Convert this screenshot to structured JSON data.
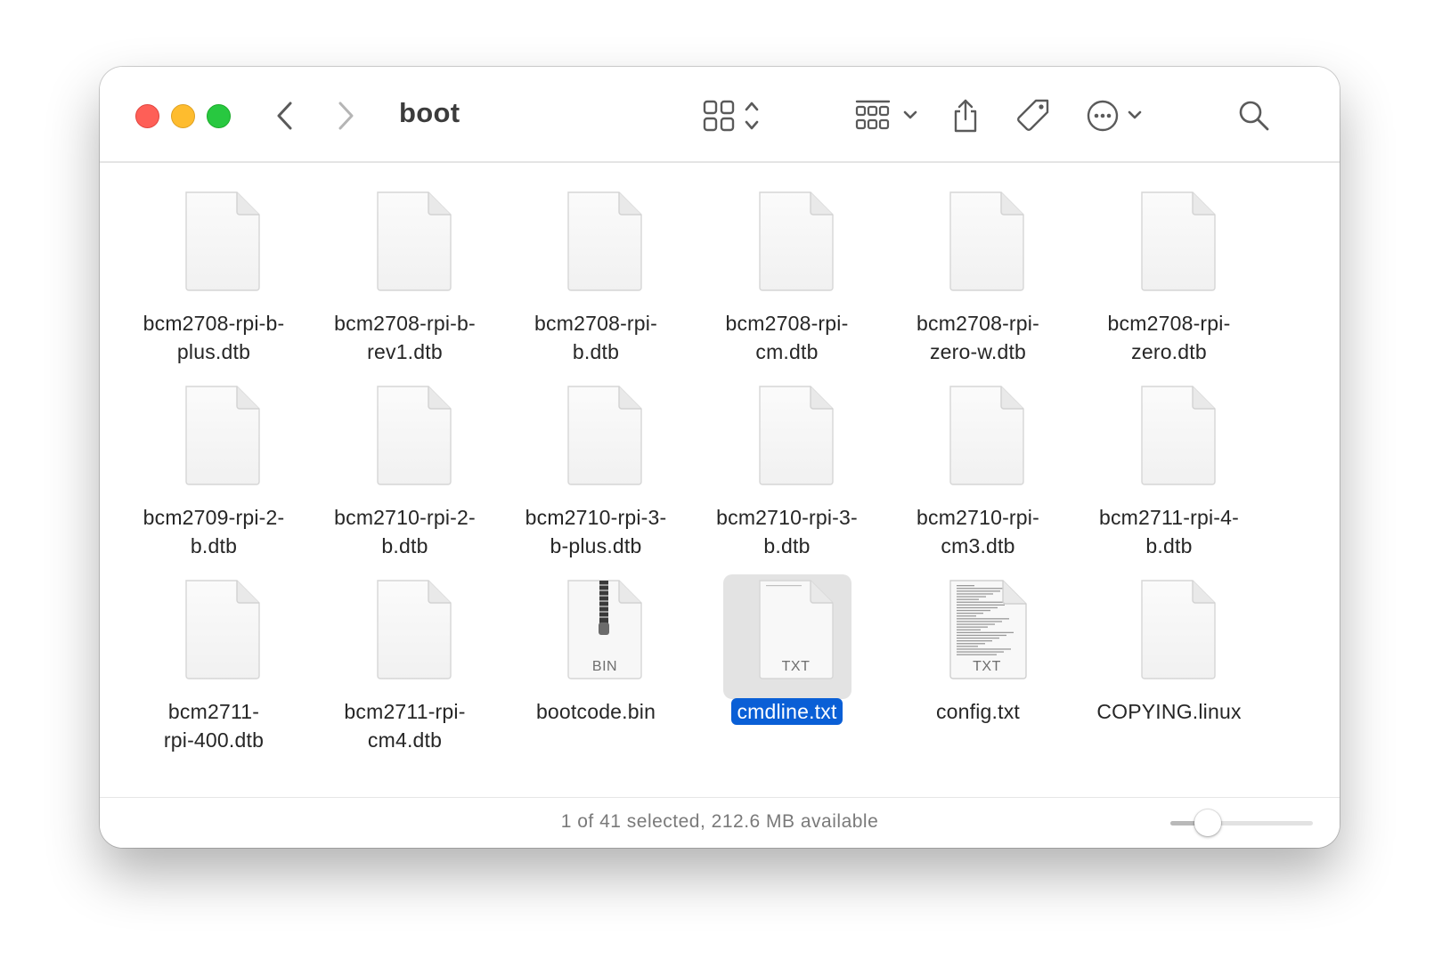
{
  "window": {
    "title": "boot",
    "traffic_lights": [
      "close",
      "minimize",
      "zoom"
    ]
  },
  "toolbar": {
    "icons": [
      "back-chevron-icon",
      "forward-chevron-icon",
      "icon-view-icon",
      "group-by-icon",
      "share-icon",
      "tag-icon",
      "more-actions-icon",
      "search-icon"
    ]
  },
  "files": [
    {
      "name": "bcm2708-rpi-b-\nplus.dtb",
      "ext": "",
      "type": "generic",
      "selected": false
    },
    {
      "name": "bcm2708-rpi-b-\nrev1.dtb",
      "ext": "",
      "type": "generic",
      "selected": false
    },
    {
      "name": "bcm2708-rpi-\nb.dtb",
      "ext": "",
      "type": "generic",
      "selected": false
    },
    {
      "name": "bcm2708-rpi-\ncm.dtb",
      "ext": "",
      "type": "generic",
      "selected": false
    },
    {
      "name": "bcm2708-rpi-\nzero-w.dtb",
      "ext": "",
      "type": "generic",
      "selected": false
    },
    {
      "name": "bcm2708-rpi-\nzero.dtb",
      "ext": "",
      "type": "generic",
      "selected": false
    },
    {
      "name": "bcm2709-rpi-2-\nb.dtb",
      "ext": "",
      "type": "generic",
      "selected": false
    },
    {
      "name": "bcm2710-rpi-2-\nb.dtb",
      "ext": "",
      "type": "generic",
      "selected": false
    },
    {
      "name": "bcm2710-rpi-3-\nb-plus.dtb",
      "ext": "",
      "type": "generic",
      "selected": false
    },
    {
      "name": "bcm2710-rpi-3-\nb.dtb",
      "ext": "",
      "type": "generic",
      "selected": false
    },
    {
      "name": "bcm2710-rpi-\ncm3.dtb",
      "ext": "",
      "type": "generic",
      "selected": false
    },
    {
      "name": "bcm2711-rpi-4-\nb.dtb",
      "ext": "",
      "type": "generic",
      "selected": false
    },
    {
      "name": "bcm2711-\nrpi-400.dtb",
      "ext": "",
      "type": "generic",
      "selected": false
    },
    {
      "name": "bcm2711-rpi-\ncm4.dtb",
      "ext": "",
      "type": "generic",
      "selected": false
    },
    {
      "name": "bootcode.bin",
      "ext": "BIN",
      "type": "archive",
      "selected": false
    },
    {
      "name": "cmdline.txt",
      "ext": "TXT",
      "type": "text",
      "selected": true
    },
    {
      "name": "config.txt",
      "ext": "TXT",
      "type": "text-preview",
      "selected": false
    },
    {
      "name": "COPYING.linux",
      "ext": "",
      "type": "generic",
      "selected": false
    }
  ],
  "statusbar": {
    "text": "1 of 41 selected, 212.6 MB available",
    "icon_size_level": 0.26
  },
  "colors": {
    "selection": "#0a5fd6",
    "close": "#fe5f57",
    "minimize": "#febc2e",
    "zoom": "#28c840"
  }
}
